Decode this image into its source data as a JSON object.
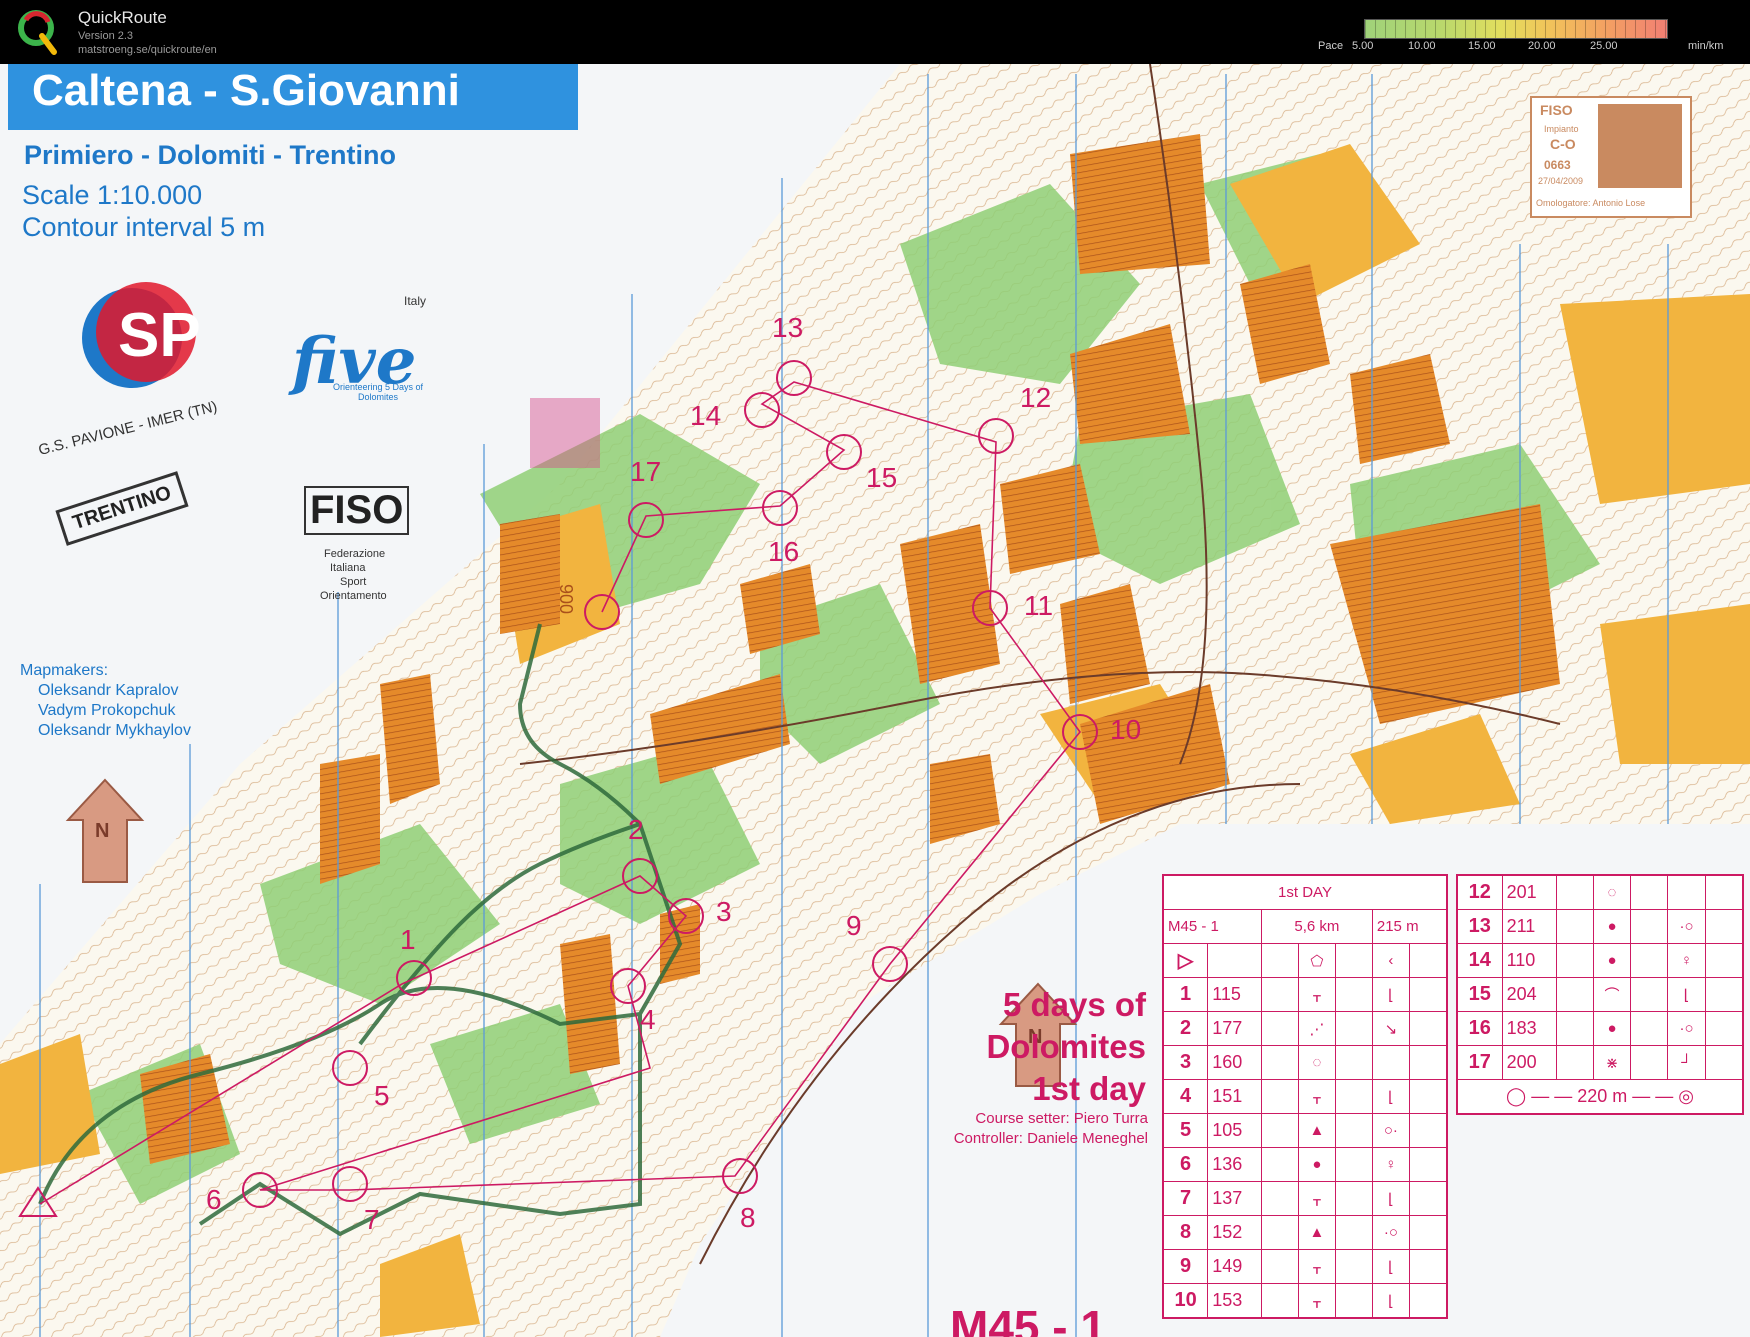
{
  "app": {
    "name": "QuickRoute",
    "version": "Version 2.3",
    "url": "matstroeng.se/quickroute/en",
    "pace_label": "Pace",
    "pace_ticks": [
      "5.00",
      "10.00",
      "15.00",
      "20.00",
      "25.00"
    ],
    "pace_unit": "min/km"
  },
  "map": {
    "title": "Caltena - S.Giovanni",
    "region": "Primiero - Dolomiti - Trentino",
    "scale": "Scale 1:10.000",
    "contour": "Contour interval 5 m",
    "club_text": "G.S. PAVIONE - IMER (TN)",
    "five_brand": "five",
    "five_tag": "Orienteering 5 Days of Dolomites",
    "five_country": "Italy",
    "trentino": "TRENTINO",
    "fiso": "FISO",
    "fiso_full": [
      "Federazione",
      "Italiana",
      "Sport",
      "Orientamento"
    ],
    "mapmakers_label": "Mapmakers:",
    "mapmakers": [
      "Oleksandr Kapralov",
      "Vadym Prokopchuk",
      "Oleksandr Mykhaylov"
    ],
    "north": "N",
    "event": [
      "5 days of",
      "Dolomites",
      "1st day"
    ],
    "course_setter": "Course setter: Piero Turra",
    "controller": "Controller: Daniele Meneghel",
    "course_big": "M45 - 1",
    "spot_height": "900",
    "stamp": {
      "org": "FISO",
      "label": "Impianto",
      "class": "C-O",
      "number": "0663",
      "date": "27/04/2009",
      "approver": "Omologatore: Antonio Lose"
    }
  },
  "controls": [
    {
      "n": "1"
    },
    {
      "n": "2"
    },
    {
      "n": "3"
    },
    {
      "n": "4"
    },
    {
      "n": "5"
    },
    {
      "n": "6"
    },
    {
      "n": "7"
    },
    {
      "n": "8"
    },
    {
      "n": "9"
    },
    {
      "n": "10"
    },
    {
      "n": "11"
    },
    {
      "n": "12"
    },
    {
      "n": "13"
    },
    {
      "n": "14"
    },
    {
      "n": "15"
    },
    {
      "n": "16"
    },
    {
      "n": "17"
    }
  ],
  "description": {
    "day": "1st DAY",
    "course": "M45 - 1",
    "length": "5,6 km",
    "climb": "215 m",
    "rows": [
      {
        "num": "1",
        "code": "115"
      },
      {
        "num": "2",
        "code": "177"
      },
      {
        "num": "3",
        "code": "160"
      },
      {
        "num": "4",
        "code": "151"
      },
      {
        "num": "5",
        "code": "105"
      },
      {
        "num": "6",
        "code": "136"
      },
      {
        "num": "7",
        "code": "137"
      },
      {
        "num": "8",
        "code": "152"
      },
      {
        "num": "9",
        "code": "149"
      },
      {
        "num": "10",
        "code": "153"
      }
    ],
    "rows2": [
      {
        "num": "12",
        "code": "201"
      },
      {
        "num": "13",
        "code": "211"
      },
      {
        "num": "14",
        "code": "110"
      },
      {
        "num": "15",
        "code": "204"
      },
      {
        "num": "16",
        "code": "183"
      },
      {
        "num": "17",
        "code": "200"
      }
    ],
    "finish": "220 m"
  }
}
